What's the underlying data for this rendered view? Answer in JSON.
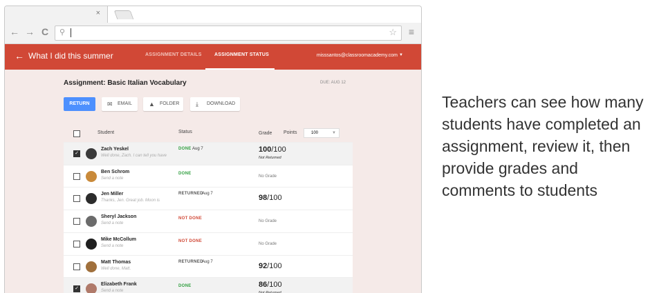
{
  "browser": {
    "tab_close": "×",
    "back_glyph": "←",
    "forward_glyph": "→",
    "reload_glyph": "C",
    "search_glyph": "⚲",
    "star_glyph": "☆",
    "menu_glyph": "≡"
  },
  "appbar": {
    "back_glyph": "←",
    "title": "What I did this summer",
    "tabs": [
      {
        "label": "ASSIGNMENT DETAILS",
        "active": false
      },
      {
        "label": "ASSIGNMENT STATUS",
        "active": true
      }
    ],
    "account": "misssantos@classroomacademy.com",
    "account_caret": "▼",
    "color": "#d14836"
  },
  "assignment": {
    "title": "Assignment: Basic Italian Vocabulary",
    "due": "DUE: AUG 12"
  },
  "actions": {
    "return_label": "RETURN",
    "email_label": "EMAIL",
    "folder_label": "FOLDER",
    "download_label": "DOWNLOAD",
    "email_icon": "✉",
    "folder_icon": "▲",
    "download_icon": "⤓"
  },
  "table": {
    "headers": {
      "student": "Student",
      "status": "Status",
      "grade": "Grade",
      "points": "Points"
    },
    "points_value": "100",
    "points_caret": "▼",
    "rows": [
      {
        "name": "Zach Yeskel",
        "note": "Well done, Zach. I can tell you have",
        "status": "DONE",
        "status_date": "Aug 7",
        "grade": "100",
        "grade_total": "/100",
        "grade_sub": "Not Returned",
        "checked": true,
        "avatar_color": "#3a3a3a"
      },
      {
        "name": "Ben Schrom",
        "note": "Send a note",
        "status": "DONE",
        "status_date": "",
        "grade": "",
        "grade_total": "",
        "grade_sub": "",
        "no_grade": "No Grade",
        "checked": false,
        "avatar_color": "#c98a3a"
      },
      {
        "name": "Jen Miller",
        "note": "Thanks, Jen. Great job. Moon is",
        "status": "RETURNED",
        "status_date": "Aug 7",
        "grade": "98",
        "grade_total": "/100",
        "grade_sub": "",
        "checked": false,
        "avatar_color": "#2c2c2c"
      },
      {
        "name": "Sheryl Jackson",
        "note": "Send a note",
        "status": "NOT DONE",
        "status_date": "",
        "grade": "",
        "grade_total": "",
        "grade_sub": "",
        "no_grade": "No Grade",
        "checked": false,
        "avatar_color": "#6b6b6b"
      },
      {
        "name": "Mike McCollum",
        "note": "Send a note",
        "status": "NOT DONE",
        "status_date": "",
        "grade": "",
        "grade_total": "",
        "grade_sub": "",
        "no_grade": "No Grade",
        "checked": false,
        "avatar_color": "#1f1f1f"
      },
      {
        "name": "Matt Thomas",
        "note": "Well done, Matt.",
        "status": "RETURNED",
        "status_date": "Aug 7",
        "grade": "92",
        "grade_total": "/100",
        "grade_sub": "",
        "checked": false,
        "avatar_color": "#a0703c"
      },
      {
        "name": "Elizabeth Frank",
        "note": "Send a note",
        "status": "DONE",
        "status_date": "",
        "grade": "86",
        "grade_total": "/100",
        "grade_sub": "Not Returned",
        "checked": true,
        "avatar_color": "#b07a6a"
      }
    ]
  },
  "status_colors": {
    "DONE": "#2e9e3e",
    "NOT DONE": "#d14836",
    "RETURNED": "#555555"
  },
  "checkbox_glyph": "✓",
  "caption": "Teachers can see how many students have completed an assignment, review it, then provide grades and comments to students"
}
